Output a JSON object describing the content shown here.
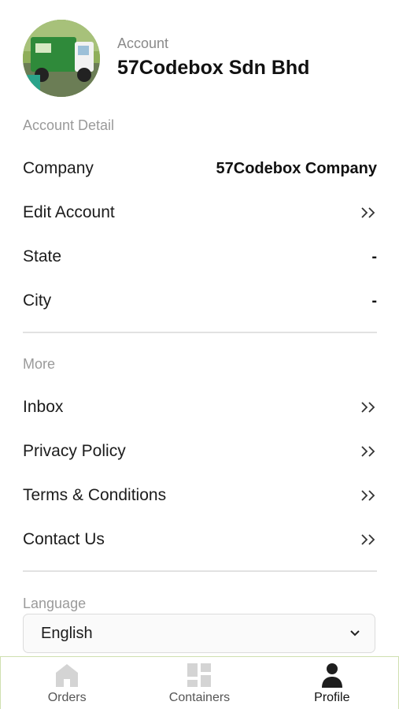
{
  "header": {
    "account_label": "Account",
    "account_name": "57Codebox Sdn Bhd"
  },
  "account_detail": {
    "title": "Account Detail",
    "rows": [
      {
        "label": "Company",
        "value": "57Codebox Company"
      },
      {
        "label": "Edit Account",
        "value": ""
      },
      {
        "label": "State",
        "value": "-"
      },
      {
        "label": "City",
        "value": "-"
      }
    ]
  },
  "more": {
    "title": "More",
    "items": [
      {
        "label": "Inbox"
      },
      {
        "label": "Privacy Policy"
      },
      {
        "label": "Terms & Conditions"
      },
      {
        "label": "Contact Us"
      }
    ]
  },
  "language": {
    "title": "Language",
    "selected": "English"
  },
  "bottom_nav": {
    "items": [
      {
        "label": "Orders",
        "icon": "home-icon"
      },
      {
        "label": "Containers",
        "icon": "grid-icon"
      },
      {
        "label": "Profile",
        "icon": "person-icon"
      }
    ],
    "active": "Profile"
  },
  "colors": {
    "inactive_icon": "#d4d4d4",
    "active_icon": "#1e1e1e",
    "nav_border": "#cfe0b0"
  }
}
